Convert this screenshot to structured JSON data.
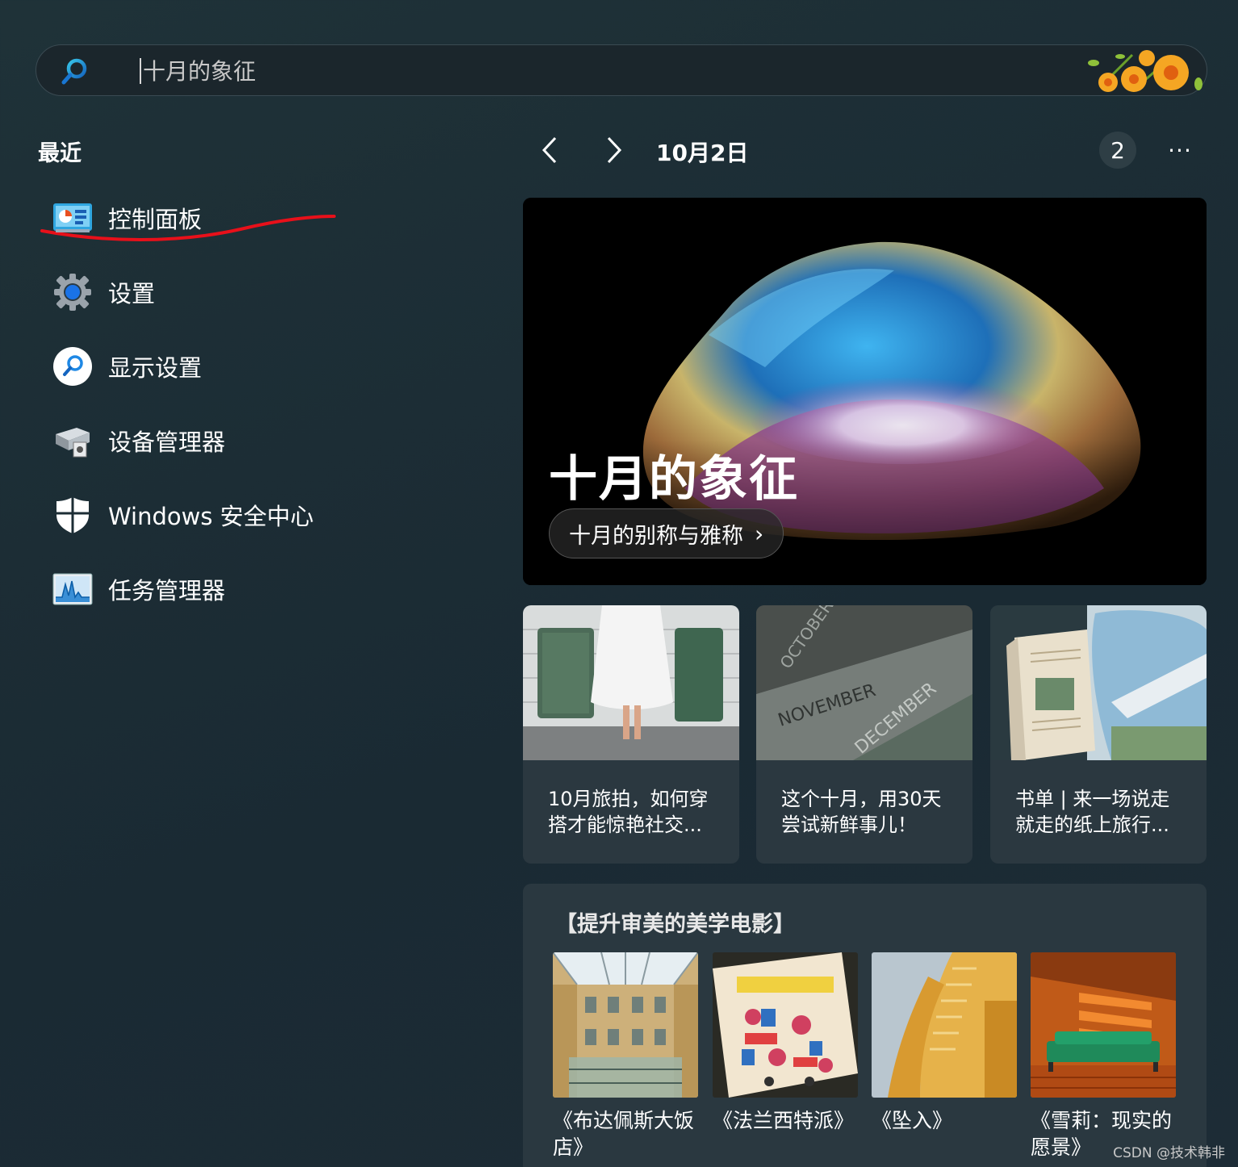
{
  "search": {
    "placeholder": "十月的象征"
  },
  "recent": {
    "title": "最近",
    "items": [
      {
        "label": "控制面板",
        "icon": "control-panel-icon"
      },
      {
        "label": "设置",
        "icon": "gear-icon"
      },
      {
        "label": "显示设置",
        "icon": "search-icon"
      },
      {
        "label": "设备管理器",
        "icon": "device-manager-icon"
      },
      {
        "label": "Windows 安全中心",
        "icon": "shield-icon"
      },
      {
        "label": "任务管理器",
        "icon": "task-manager-icon"
      }
    ]
  },
  "header": {
    "date": "10月2日",
    "badge": "2",
    "more": "···"
  },
  "hero": {
    "title": "十月的象征",
    "pill_label": "十月的别称与雅称",
    "pill_arrow": "›"
  },
  "cards": [
    {
      "caption": "10月旅拍，如何穿搭才能惊艳社交..."
    },
    {
      "caption": "这个十月，用30天尝试新鲜事儿！"
    },
    {
      "caption": "书单 | 来一场说走就走的纸上旅行..."
    }
  ],
  "calendar_card": {
    "words": [
      "OCTOBER",
      "NOVEMBER",
      "DECEMBER"
    ]
  },
  "movies": {
    "title": "【提升审美的美学电影】",
    "items": [
      {
        "name": "《布达佩斯大饭店》"
      },
      {
        "name": "《法兰西特派》"
      },
      {
        "name": "《坠入》"
      },
      {
        "name": "《雪莉：现实的愿景》"
      }
    ]
  },
  "watermark": "CSDN @技术韩非",
  "colors": {
    "accent": "#0a84d8",
    "annotation_red": "#e8101a"
  }
}
